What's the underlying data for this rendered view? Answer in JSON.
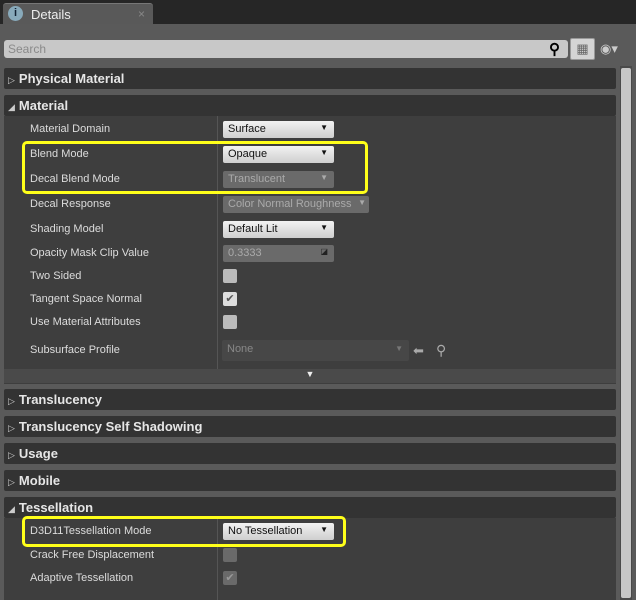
{
  "tab": {
    "title": "Details",
    "icon": "details-info-icon",
    "close": "×"
  },
  "search": {
    "placeholder": "Search",
    "value": ""
  },
  "icons": {
    "search": "search-icon",
    "view": "grid-view-icon",
    "eye": "eye-visibility-icon"
  },
  "categories": {
    "physical_material": "Physical Material",
    "material": "Material",
    "translucency": "Translucency",
    "translucency_self_shadowing": "Translucency Self Shadowing",
    "usage": "Usage",
    "mobile": "Mobile",
    "tessellation": "Tessellation"
  },
  "material": {
    "material_domain": {
      "label": "Material Domain",
      "value": "Surface"
    },
    "blend_mode": {
      "label": "Blend Mode",
      "value": "Opaque"
    },
    "decal_blend_mode": {
      "label": "Decal Blend Mode",
      "value": "Translucent"
    },
    "decal_response": {
      "label": "Decal Response",
      "value": "Color Normal Roughness"
    },
    "shading_model": {
      "label": "Shading Model",
      "value": "Default Lit"
    },
    "opacity_mask_clip": {
      "label": "Opacity Mask Clip Value",
      "value": "0.3333"
    },
    "two_sided": {
      "label": "Two Sided",
      "checked": false
    },
    "tangent_space_normal": {
      "label": "Tangent Space Normal",
      "checked": true
    },
    "use_material_attributes": {
      "label": "Use Material Attributes",
      "checked": false
    },
    "subsurface_profile": {
      "label": "Subsurface Profile",
      "value": "None"
    }
  },
  "tessellation": {
    "mode": {
      "label": "D3D11Tessellation Mode",
      "value": "No Tessellation"
    },
    "crack_free": {
      "label": "Crack Free Displacement",
      "checked": false
    },
    "adaptive": {
      "label": "Adaptive Tessellation",
      "checked": true
    }
  },
  "highlight_color": "#ffff1a"
}
